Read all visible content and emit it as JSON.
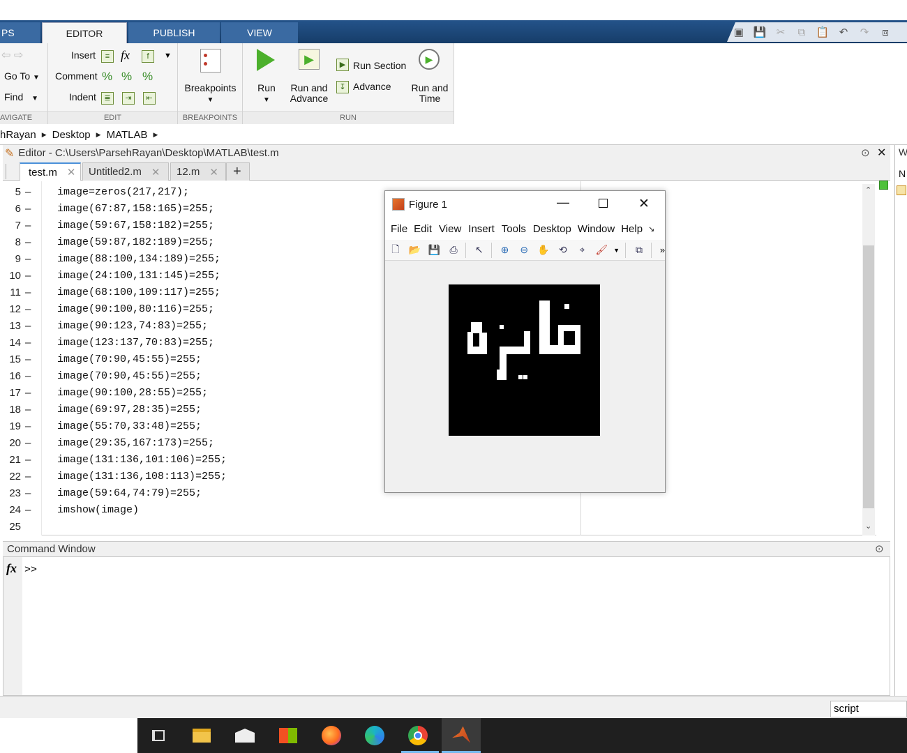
{
  "ribbon_tabs": {
    "apps_partial": "PS",
    "editor": "EDITOR",
    "publish": "PUBLISH",
    "view": "VIEW"
  },
  "navigate": {
    "go_to": "Go To",
    "find": "Find",
    "label": "AVIGATE"
  },
  "edit": {
    "insert": "Insert",
    "comment": "Comment",
    "indent": "Indent",
    "label": "EDIT"
  },
  "breakpoints": {
    "button": "Breakpoints",
    "label": "BREAKPOINTS"
  },
  "run": {
    "run": "Run",
    "run_and_advance_1": "Run and",
    "run_and_advance_2": "Advance",
    "run_section": "Run Section",
    "advance": "Advance",
    "run_and_time_1": "Run and",
    "run_and_time_2": "Time",
    "label": "RUN"
  },
  "path": {
    "parts": [
      "hRayan",
      "Desktop",
      "MATLAB"
    ]
  },
  "editor": {
    "title": "Editor - C:\\Users\\ParsehRayan\\Desktop\\MATLAB\\test.m",
    "tabs": [
      "test.m",
      "Untitled2.m",
      "12.m"
    ],
    "lines": [
      {
        "n": "5",
        "dash": "–",
        "code": "image=zeros(217,217);"
      },
      {
        "n": "6",
        "dash": "–",
        "code": "image(67:87,158:165)=255;"
      },
      {
        "n": "7",
        "dash": "–",
        "code": "image(59:67,158:182)=255;"
      },
      {
        "n": "8",
        "dash": "–",
        "code": "image(59:87,182:189)=255;"
      },
      {
        "n": "9",
        "dash": "–",
        "code": "image(88:100,134:189)=255;"
      },
      {
        "n": "10",
        "dash": "–",
        "code": "image(24:100,131:145)=255;"
      },
      {
        "n": "11",
        "dash": "–",
        "code": "image(68:100,109:117)=255;"
      },
      {
        "n": "12",
        "dash": "–",
        "code": "image(90:100,80:116)=255;"
      },
      {
        "n": "13",
        "dash": "–",
        "code": "image(90:123,74:83)=255;"
      },
      {
        "n": "14",
        "dash": "–",
        "code": "image(123:137,70:83)=255;"
      },
      {
        "n": "15",
        "dash": "–",
        "code": "image(70:90,45:55)=255;"
      },
      {
        "n": "16",
        "dash": "–",
        "code": "image(70:90,45:55)=255;"
      },
      {
        "n": "17",
        "dash": "–",
        "code": "image(90:100,28:55)=255;"
      },
      {
        "n": "18",
        "dash": "–",
        "code": "image(69:97,28:35)=255;"
      },
      {
        "n": "19",
        "dash": "–",
        "code": "image(55:70,33:48)=255;"
      },
      {
        "n": "20",
        "dash": "–",
        "code": "image(29:35,167:173)=255;"
      },
      {
        "n": "21",
        "dash": "–",
        "code": "image(131:136,101:106)=255;"
      },
      {
        "n": "22",
        "dash": "–",
        "code": "image(131:136,108:113)=255;"
      },
      {
        "n": "23",
        "dash": "–",
        "code": "image(59:64,74:79)=255;"
      },
      {
        "n": "24",
        "dash": "–",
        "code": "imshow(image)"
      },
      {
        "n": "25",
        "dash": "",
        "code": ""
      }
    ]
  },
  "right_partial": {
    "w": "W",
    "n": "N"
  },
  "command_window": {
    "title": "Command Window",
    "fx": "fx",
    "prompt": ">>"
  },
  "status": {
    "mode": "script"
  },
  "figure": {
    "title": "Figure 1",
    "menu": [
      "File",
      "Edit",
      "View",
      "Insert",
      "Tools",
      "Desktop",
      "Window",
      "Help"
    ],
    "image_size": 217,
    "white_rects": [
      [
        67,
        87,
        158,
        165
      ],
      [
        59,
        67,
        158,
        182
      ],
      [
        59,
        87,
        182,
        189
      ],
      [
        88,
        100,
        134,
        189
      ],
      [
        24,
        100,
        131,
        145
      ],
      [
        68,
        100,
        109,
        117
      ],
      [
        90,
        100,
        80,
        116
      ],
      [
        90,
        123,
        74,
        83
      ],
      [
        123,
        137,
        70,
        83
      ],
      [
        70,
        90,
        45,
        55
      ],
      [
        90,
        100,
        28,
        55
      ],
      [
        69,
        97,
        28,
        35
      ],
      [
        55,
        70,
        33,
        48
      ],
      [
        29,
        35,
        167,
        173
      ],
      [
        131,
        136,
        101,
        106
      ],
      [
        131,
        136,
        108,
        113
      ],
      [
        59,
        64,
        74,
        79
      ]
    ]
  }
}
